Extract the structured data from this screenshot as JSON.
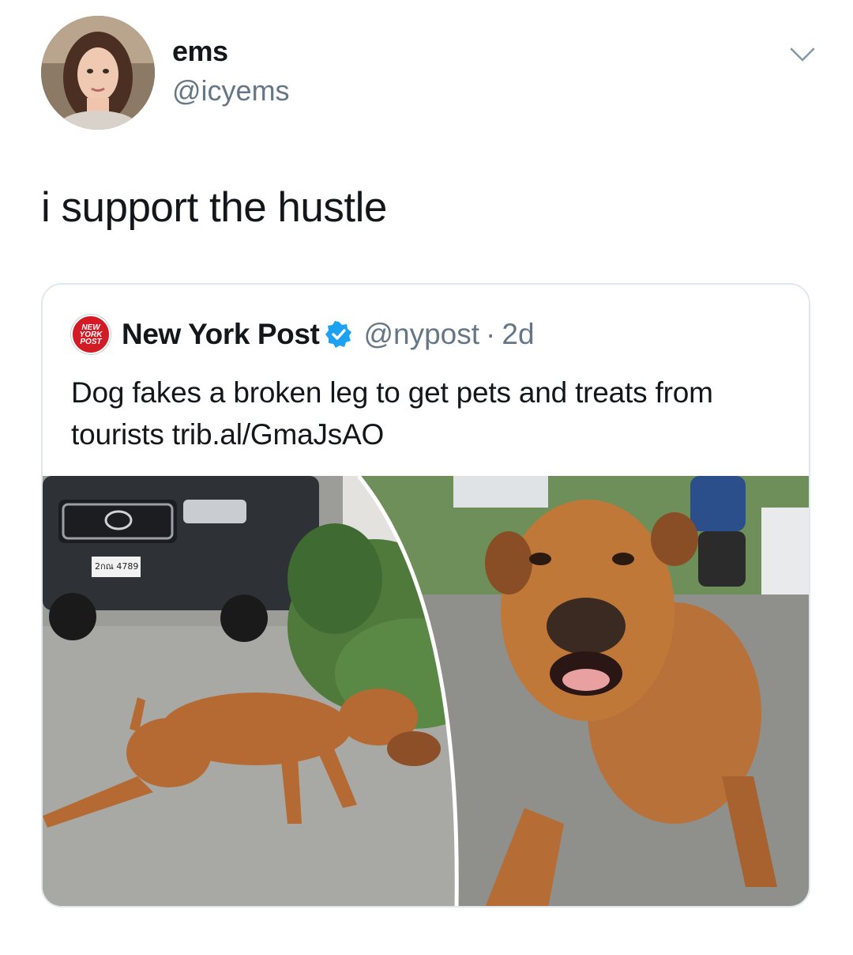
{
  "tweet": {
    "display_name": "ems",
    "handle": "@icyems",
    "text": "i support the hustle"
  },
  "quote": {
    "logo_text": [
      "NEW",
      "YORK",
      "POST"
    ],
    "account_name": "New York Post",
    "handle": "@nypost",
    "separator": "·",
    "time": "2d",
    "text": "Dog fakes a broken leg to get pets and treats from tourists trib.al/GmaJsAO"
  },
  "media": {
    "license_plate": "2กณ 4789"
  },
  "icons": {
    "menu": "chevron-down-icon",
    "verified": "verified-badge-icon"
  },
  "colors": {
    "secondary_text": "#657786",
    "verified": "#1da1f2",
    "nypost_red": "#d21b24",
    "card_border": "#e1e8ed"
  }
}
